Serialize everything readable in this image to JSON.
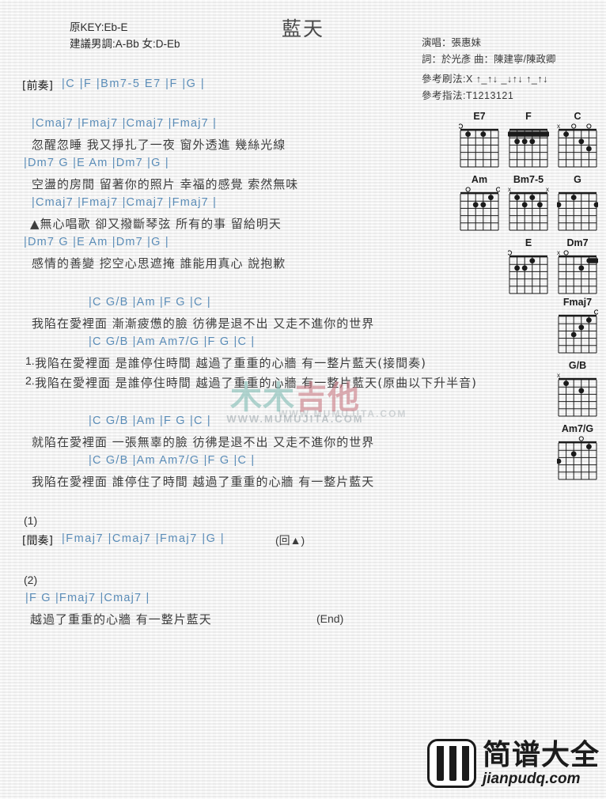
{
  "document": {
    "title": "藍天",
    "original_key_label": "原KEY:Eb-E",
    "suggested_key_label": "建議男調:A-Bb 女:D-Eb",
    "singer": "演唱：張惠妹",
    "credits": "詞：於光彥  曲：陳建寧/陳政卿",
    "strum_pattern": "參考刷法:X ↑_↑↓ _↓↑↓ ↑_↑↓",
    "finger_pattern": "參考指法:T1213121"
  },
  "sections": {
    "intro_label": "[前奏]",
    "intro_chords": "|C    |F    |Bm7-5  E7   |F   |G   |",
    "interlude_label": "[間奏]",
    "interlude_chords": "|Fmaj7   |Cmaj7   |Fmaj7   |G   |",
    "interlude_repeat": "(回▲)",
    "ending_marker": "(End)",
    "marker_1": "(1)",
    "marker_2": "(2)",
    "verse_number_1": "1.",
    "verse_number_2": "2."
  },
  "lines": [
    {
      "id": "v1-c1",
      "chords": "|Cmaj7          |Fmaj7    |Cmaj7              |Fmaj7   |"
    },
    {
      "id": "v1-l1",
      "lyric": "忽醒忽睡  我又掙扎了一夜  窗外透進  幾絲光線"
    },
    {
      "id": "v1-c2",
      "chords": "|Dm7     G   |E             Am   |Dm7            |G     |"
    },
    {
      "id": "v1-l2",
      "lyric": "空盪的房間  留著你的照片  幸福的感覺  索然無味"
    },
    {
      "id": "v2-c1",
      "chords": "|Cmaj7          |Fmaj7   |Cmaj7            |Fmaj7   |"
    },
    {
      "id": "v2-l1",
      "lyric": "▲無心唱歌  卻又撥斷琴弦  所有的事  留給明天"
    },
    {
      "id": "v2-c2",
      "chords": "|Dm7     G   |E             Am   |Dm7            |G     |"
    },
    {
      "id": "v2-l2",
      "lyric": "感情的善變  挖空心思遮掩  誰能用真心  說抱歉"
    },
    {
      "id": "ch1-c1",
      "chords": "|C   G/B       |Am                   |F               G            |C   |"
    },
    {
      "id": "ch1-l1",
      "lyric": "我陷在愛裡面  漸漸疲憊的臉  彷彿是退不出  又走不進你的世界"
    },
    {
      "id": "ch1-c2",
      "chords": "|C   G/B       |Am   Am7/G  |F           G            |C   |"
    },
    {
      "id": "ch1-l2a",
      "lyric": "我陷在愛裡面  是誰停住時間     越過了重重的心牆  有一整片藍天(接間奏)"
    },
    {
      "id": "ch1-l2b",
      "lyric": "我陷在愛裡面  是誰停住時間     越過了重重的心牆  有一整片藍天(原曲以下升半音)"
    },
    {
      "id": "ch2-c1",
      "chords": "|C   G/B       |Am                   |F          G        |C   |"
    },
    {
      "id": "ch2-l1",
      "lyric": "就陷在愛裡面  一張無辜的臉  彷彿是退不出  又走不進你的世界"
    },
    {
      "id": "ch2-c2",
      "chords": "|C   G/B       |Am   Am7/G  |F           G          |C   |"
    },
    {
      "id": "ch2-l2",
      "lyric": "我陷在愛裡面  誰停住了時間  越過了重重的心牆  有一整片藍天"
    },
    {
      "id": "end-c1",
      "chords": "|F          G                           |Fmaj7   |Cmaj7   |"
    },
    {
      "id": "end-l1",
      "lyric": "越過了重重的心牆  有一整片藍天"
    }
  ],
  "chord_diagrams": [
    {
      "name": "E7",
      "markers": [
        "o",
        "",
        "",
        "",
        "",
        ""
      ],
      "dots": [
        {
          "s": 2,
          "f": 1
        },
        {
          "s": 4,
          "f": 1
        }
      ],
      "barre": null
    },
    {
      "name": "F",
      "markers": [
        "",
        "",
        "",
        "",
        "",
        ""
      ],
      "dots": [
        {
          "s": 3,
          "f": 2
        },
        {
          "s": 4,
          "f": 2
        },
        {
          "s": 2,
          "f": 2
        }
      ],
      "barre": {
        "fret": 1,
        "from": 1,
        "to": 6
      }
    },
    {
      "name": "C",
      "markers": [
        "x",
        "",
        "o",
        "",
        "o",
        ""
      ],
      "dots": [
        {
          "s": 2,
          "f": 1
        },
        {
          "s": 4,
          "f": 2
        },
        {
          "s": 5,
          "f": 3
        }
      ],
      "barre": null
    },
    {
      "name": "Am",
      "markers": [
        "",
        "o",
        "",
        "",
        "",
        "o"
      ],
      "dots": [
        {
          "s": 3,
          "f": 2
        },
        {
          "s": 4,
          "f": 2
        },
        {
          "s": 5,
          "f": 1
        }
      ],
      "barre": null
    },
    {
      "name": "Bm7-5",
      "markers": [
        "x",
        "",
        "",
        "",
        "",
        "x"
      ],
      "dots": [
        {
          "s": 2,
          "f": 1
        },
        {
          "s": 3,
          "f": 2
        },
        {
          "s": 4,
          "f": 1
        },
        {
          "s": 5,
          "f": 2
        }
      ],
      "barre": null
    },
    {
      "name": "G",
      "markers": [
        "",
        "",
        "",
        "",
        "",
        ""
      ],
      "dots": [
        {
          "s": 1,
          "f": 2
        },
        {
          "s": 3,
          "f": 1
        },
        {
          "s": 6,
          "f": 2
        }
      ],
      "barre": null
    },
    {
      "name": "E",
      "markers": [
        "o",
        "",
        "",
        "",
        "",
        ""
      ],
      "dots": [
        {
          "s": 2,
          "f": 2
        },
        {
          "s": 3,
          "f": 2
        },
        {
          "s": 4,
          "f": 1
        }
      ],
      "barre": null
    },
    {
      "name": "Dm7",
      "markers": [
        "x",
        "o",
        "",
        "",
        "",
        ""
      ],
      "dots": [
        {
          "s": 4,
          "f": 2
        }
      ],
      "barre": {
        "fret": 1,
        "from": 5,
        "to": 6
      }
    },
    {
      "name": "Fmaj7",
      "markers": [
        "",
        "",
        "",
        "",
        "",
        "o"
      ],
      "dots": [
        {
          "s": 3,
          "f": 3
        },
        {
          "s": 4,
          "f": 2
        },
        {
          "s": 5,
          "f": 1
        }
      ],
      "barre": null
    },
    {
      "name": "G/B",
      "markers": [
        "x",
        "",
        "",
        "",
        "",
        ""
      ],
      "dots": [
        {
          "s": 2,
          "f": 1
        },
        {
          "s": 4,
          "f": 2
        }
      ],
      "barre": null
    },
    {
      "name": "Am7/G",
      "markers": [
        "",
        "",
        "",
        "o",
        "",
        ""
      ],
      "dots": [
        {
          "s": 1,
          "f": 3
        },
        {
          "s": 3,
          "f": 2
        },
        {
          "s": 5,
          "f": 1
        }
      ],
      "barre": null
    }
  ],
  "watermark": {
    "text_part1": "木木",
    "text_part2": "吉他",
    "url": "WWW.MUMUJITA.COM"
  },
  "logo": {
    "name_cn": "简谱大全",
    "name_en": "jianpudq.com",
    "icon": "piano-keys-icon"
  }
}
